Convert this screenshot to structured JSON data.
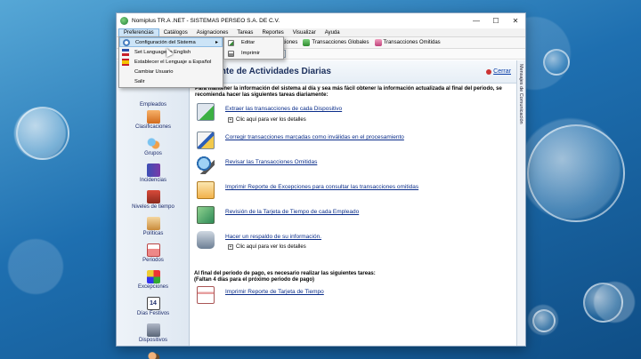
{
  "window": {
    "title": "Nomiplus TR.A .NET - SISTEMAS PERSEO S.A. DE C.V.",
    "controls": {
      "minimize": "—",
      "maximize": "☐",
      "close": "✕"
    }
  },
  "menubar": {
    "items": [
      "Preferencias",
      "Catálogos",
      "Asignaciones",
      "Tareas",
      "Reportes",
      "Visualizar",
      "Ayuda"
    ]
  },
  "toolbar": {
    "buttons": [
      {
        "label": "Reprocesar Transacciones"
      },
      {
        "label": "Transacciones Globales"
      },
      {
        "label": "Transacciones Omitidas"
      }
    ]
  },
  "subbar": {
    "field_text": "co"
  },
  "preferences_menu": {
    "items": [
      {
        "label": "Configuración del Sistema",
        "has_submenu": true
      },
      {
        "label": "Set Language to English"
      },
      {
        "label": "Establecer el Lenguaje a Español"
      },
      {
        "label": "Cambiar Usuario"
      },
      {
        "label": "Salir"
      }
    ],
    "submenu": [
      {
        "label": "Editar"
      },
      {
        "label": "Imprimir"
      }
    ]
  },
  "sidebar": {
    "items": [
      {
        "label": "Empleados"
      },
      {
        "label": "Clasificaciones"
      },
      {
        "label": "Grupos"
      },
      {
        "label": "Incidencias"
      },
      {
        "label": "Niveles de tiempo"
      },
      {
        "label": "Políticas"
      },
      {
        "label": "Periodos"
      },
      {
        "label": "Excepciones"
      },
      {
        "label": "Días Festivos"
      },
      {
        "label": "Dispositivos"
      }
    ],
    "festivos_number": "14"
  },
  "main": {
    "title": "sistente de Actividades Diarias",
    "close_label": "Cerrar",
    "intro": "Para mantener la información del sistema al día y sea más fácil obtener la información actualizada al final del periodo, se recomienda hacer las siguientes tareas diariamente:",
    "tasks": [
      {
        "label": "Extraer las transacciones de cada Dispositivo"
      },
      {
        "label": "Corregir transacciones marcadas como inválidas en el procesamiento"
      },
      {
        "label": "Revisar las Transacciones Omitidas"
      },
      {
        "label": "Imprimir Reporte de Excepciones para consultar las transacciones omitidas"
      },
      {
        "label": "Revisión de la Tarjeta de Tiempo de cada Empleado"
      },
      {
        "label": "Hacer un respaldo de su información."
      }
    ],
    "details_label": "Clic aquí para ver los detalles",
    "footer_line1": "Al final del periodo de pago, es necesario realizar las siguientes tareas:",
    "footer_line2": "(Faltan 4 días para el próximo periodo de pago)",
    "footer_task": "Imprimir Reporte de Tarjeta de Tiempo",
    "side_label": "Mensajes de Comunicación"
  }
}
